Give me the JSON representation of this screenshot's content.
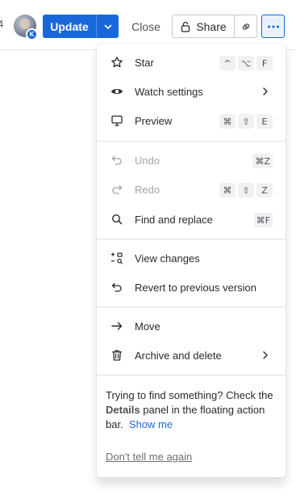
{
  "toolbar": {
    "edge_text": "4",
    "avatar_badge": "K",
    "update_label": "Update",
    "close_label": "Close",
    "share_label": "Share"
  },
  "menu": {
    "items": [
      {
        "label": "Star",
        "icon": "star-icon",
        "keys": [
          "^",
          "⌥",
          "F"
        ]
      },
      {
        "label": "Watch settings",
        "icon": "eye-icon",
        "submenu": true
      },
      {
        "label": "Preview",
        "icon": "monitor-icon",
        "keys": [
          "⌘",
          "⇧",
          "E"
        ]
      },
      {
        "label": "Undo",
        "icon": "undo-icon",
        "disabled": true,
        "keys": [
          "⌘Z"
        ]
      },
      {
        "label": "Redo",
        "icon": "redo-icon",
        "disabled": true,
        "keys": [
          "⌘",
          "⇧",
          "Z"
        ]
      },
      {
        "label": "Find and replace",
        "icon": "search-icon",
        "keys": [
          "⌘F"
        ]
      },
      {
        "label": "View changes",
        "icon": "view-changes-icon"
      },
      {
        "label": "Revert to previous version",
        "icon": "revert-icon"
      },
      {
        "label": "Move",
        "icon": "arrow-right-icon"
      },
      {
        "label": "Archive and delete",
        "icon": "trash-icon",
        "submenu": true
      }
    ],
    "tip": {
      "text_before": "Trying to find something? Check the ",
      "bold": "Details",
      "text_after": " panel in the floating action bar.",
      "link": "Show me"
    },
    "dismiss": "Don't tell me again"
  },
  "colors": {
    "primary": "#1868db",
    "text": "#292a2e",
    "muted": "#a0a3ab"
  }
}
